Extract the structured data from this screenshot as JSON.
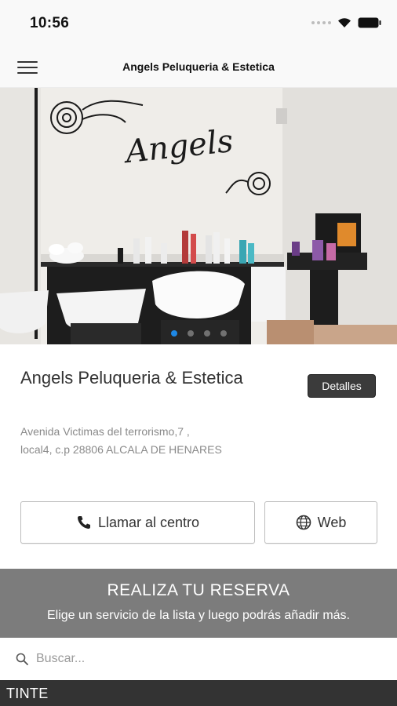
{
  "status_bar": {
    "time": "10:56"
  },
  "nav": {
    "title": "Angels Peluqueria & Estetica"
  },
  "hero": {
    "brand_text": "Angels",
    "slides": 4,
    "active_slide": 1
  },
  "salon": {
    "name": "Angels Peluqueria & Estetica",
    "details_label": "Detalles",
    "address_line1": "Avenida Victimas del terrorismo,7 ,",
    "address_line2": "local4, c.p 28806 ALCALA DE HENARES"
  },
  "actions": {
    "call_label": "Llamar al centro",
    "web_label": "Web"
  },
  "booking": {
    "title": "REALIZA TU RESERVA",
    "subtitle": "Elige un servicio de la lista y luego podrás añadir más."
  },
  "search": {
    "placeholder": "Buscar..."
  },
  "category": {
    "label": "TINTE"
  },
  "colors": {
    "accent_dot": "#1e88e5",
    "booking_bg": "#7c7c7c",
    "category_bg": "#333333",
    "details_bg": "#3b3b3b"
  }
}
